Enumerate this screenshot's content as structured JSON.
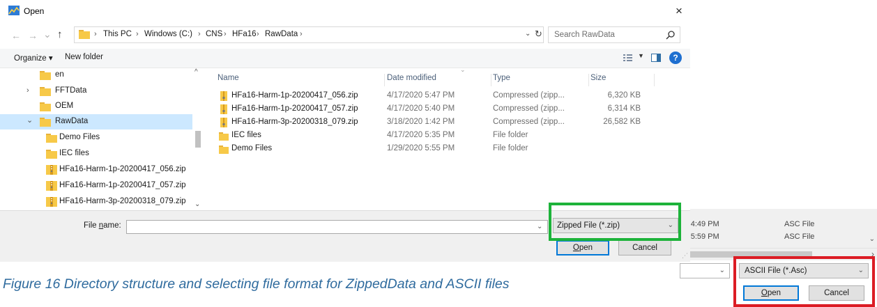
{
  "dialog": {
    "title": "Open",
    "close_glyph": "×"
  },
  "nav": {
    "back_glyph": "←",
    "forward_glyph": "→",
    "recent_glyph": "⌄",
    "up_glyph": "↑",
    "breadcrumbs": [
      "This PC",
      "Windows (C:)",
      "CNS",
      "HFa16",
      "RawData"
    ],
    "crumb_sep": "›",
    "search_placeholder": "Search RawData"
  },
  "toolbar": {
    "organize": "Organize ▾",
    "new_folder": "New folder"
  },
  "tree": [
    {
      "label": "en",
      "chevron": "",
      "indent": 0,
      "icon": "folder"
    },
    {
      "label": "FFTData",
      "chevron": "›",
      "indent": 0,
      "icon": "folder"
    },
    {
      "label": "OEM",
      "chevron": "",
      "indent": 0,
      "icon": "folder"
    },
    {
      "label": "RawData",
      "chevron": "⌄",
      "indent": 0,
      "icon": "folder",
      "selected": true
    },
    {
      "label": "Demo Files",
      "chevron": "",
      "indent": 1,
      "icon": "folder"
    },
    {
      "label": "IEC files",
      "chevron": "",
      "indent": 1,
      "icon": "folder"
    },
    {
      "label": "HFa16-Harm-1p-20200417_056.zip",
      "chevron": "",
      "indent": 1,
      "icon": "zip"
    },
    {
      "label": "HFa16-Harm-1p-20200417_057.zip",
      "chevron": "",
      "indent": 1,
      "icon": "zip"
    },
    {
      "label": "HFa16-Harm-3p-20200318_079.zip",
      "chevron": "",
      "indent": 1,
      "icon": "zip"
    }
  ],
  "columns": {
    "name": "Name",
    "date": "Date modified",
    "type": "Type",
    "size": "Size"
  },
  "files": [
    {
      "name": "HFa16-Harm-1p-20200417_056.zip",
      "date": "4/17/2020 5:47 PM",
      "type": "Compressed (zipp...",
      "size": "6,320 KB",
      "icon": "zip"
    },
    {
      "name": "HFa16-Harm-1p-20200417_057.zip",
      "date": "4/17/2020 5:40 PM",
      "type": "Compressed (zipp...",
      "size": "6,314 KB",
      "icon": "zip"
    },
    {
      "name": "HFa16-Harm-3p-20200318_079.zip",
      "date": "3/18/2020 1:42 PM",
      "type": "Compressed (zipp...",
      "size": "26,582 KB",
      "icon": "zip"
    },
    {
      "name": "IEC files",
      "date": "4/17/2020 5:35 PM",
      "type": "File folder",
      "size": "",
      "icon": "folder"
    },
    {
      "name": "Demo Files",
      "date": "1/29/2020 5:55 PM",
      "type": "File folder",
      "size": "",
      "icon": "folder"
    }
  ],
  "bottom": {
    "file_name_label_pre": "File ",
    "file_name_label_u": "n",
    "file_name_label_post": "ame:",
    "file_name_value": "",
    "file_type": "Zipped File (*.zip)",
    "open_u": "O",
    "open_rest": "pen",
    "cancel": "Cancel"
  },
  "background_dialog": {
    "rows": [
      {
        "time": ") 4:49 PM",
        "type": "ASC File"
      },
      {
        "time": ") 5:59 PM",
        "type": "ASC File"
      }
    ],
    "file_type": "ASCII File (*.Asc)",
    "open_u": "O",
    "open_rest": "pen",
    "cancel": "Cancel"
  },
  "caption": "Figure 16 Directory structure and selecting file format for ZippedData and ASCII files",
  "colors": {
    "highlight_green": "#1db33a",
    "highlight_red": "#dc1c24",
    "caption_blue": "#2f6b9e",
    "selection_blue": "#cce8ff",
    "folder_yellow": "#f7c948"
  }
}
